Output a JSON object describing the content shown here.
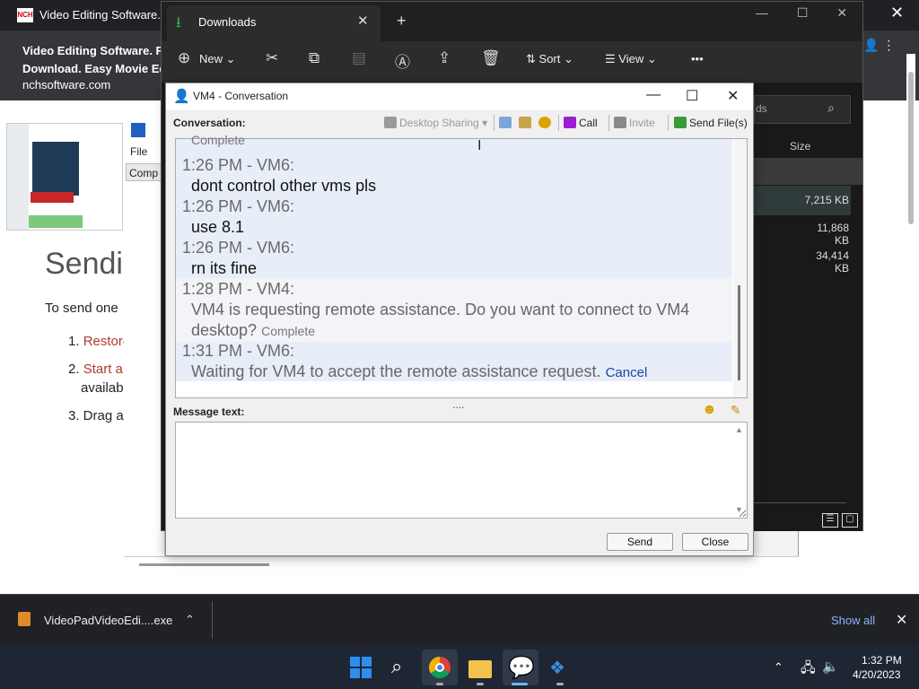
{
  "browser": {
    "tab_title": "Video Editing Software. Fr",
    "logo_text": "NCH",
    "notification_title_line1": "Video Editing Software. Fr",
    "notification_title_line2": "Download. Easy Movie Edi",
    "notification_url": "nchsoftware.com",
    "close_glyph": "✕",
    "right_icons": "👤 ⋮"
  },
  "web_page": {
    "heading": "Sendin",
    "intro": "To send one",
    "step1_num": "1.",
    "step1_link": "Restore",
    "step2_num": "2.",
    "step2_link": "Start a",
    "step2_cont": "availab",
    "step3": "3. Drag a"
  },
  "mid_window": {
    "menu_file": "File",
    "tab_comp": "Comp"
  },
  "explorer": {
    "tab_title": "Downloads",
    "tab_close": "✕",
    "tab_add": "+",
    "window_controls": "— ☐ ✕",
    "toolbar": {
      "new_label": "New",
      "sort_label": "Sort",
      "view_label": "View",
      "more": "•••"
    },
    "search_placeholder": "ds",
    "size_header": "Size",
    "sizes": [
      "7,215 KB",
      "11,868 KB",
      "34,414 KB"
    ]
  },
  "dialog": {
    "title": "VM4 - Conversation",
    "min": "—",
    "max": "☐",
    "close": "✕",
    "conversation_label": "Conversation:",
    "toolbar": {
      "desktop_sharing": "Desktop Sharing",
      "call": "Call",
      "invite": "Invite",
      "send_files": "Send File(s)"
    },
    "messages": [
      {
        "text": "Complete"
      },
      {
        "ts": "1:26 PM - VM6:",
        "text": "dont control other vms pls"
      },
      {
        "ts": "1:26 PM - VM6:",
        "text": "use 8.1"
      },
      {
        "ts": "1:26 PM - VM6:",
        "text": "rn its fine"
      },
      {
        "ts": "1:28 PM - VM4:",
        "text_line1": "VM4 is requesting remote assistance. Do you want to connect to VM4",
        "text_line2": "desktop?",
        "status": "Complete"
      },
      {
        "ts": "1:31 PM - VM6:",
        "text": "Waiting for VM4 to accept the remote assistance request.",
        "link": "Cancel"
      }
    ],
    "splitter": "....",
    "message_text_label": "Message text:",
    "message_value": "",
    "send_label": "Send",
    "close_label": "Close"
  },
  "download_shelf": {
    "file_name": "VideoPadVideoEdi....exe",
    "chevron": "⌃",
    "show_all": "Show all",
    "close": "✕"
  },
  "taskbar": {
    "time": "1:32 PM",
    "date": "4/20/2023",
    "tray_up": "⌃"
  }
}
